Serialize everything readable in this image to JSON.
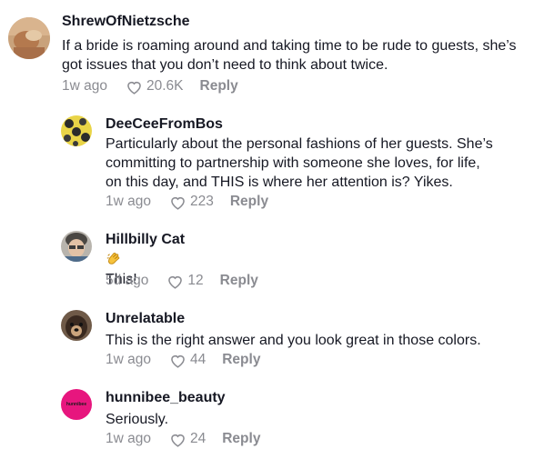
{
  "comments": [
    {
      "username": "ShrewOfNietzsche",
      "text": "If a bride is roaming around and taking time to be rude to guests, she’s got issues that you don’t need to think about twice.",
      "time": "1w ago",
      "likes": "20.6K",
      "reply_label": "Reply"
    },
    {
      "username": "DeeCeeFromBos",
      "text": "Particularly about the personal fashions of her guests. She’s committing to partnership with someone she loves, for life, on this day, and THIS is where her attention is? Yikes.",
      "time": "1w ago",
      "likes": "223",
      "reply_label": "Reply"
    },
    {
      "username": "Hillbilly Cat",
      "text": "This!",
      "emoji": "clapping-hands-emoji",
      "time": "5d ago",
      "likes": "12",
      "reply_label": "Reply"
    },
    {
      "username": "Unrelatable",
      "text": "This is the right answer and you look great in those colors.",
      "time": "1w ago",
      "likes": "44",
      "reply_label": "Reply"
    },
    {
      "username": "hunnibee_beauty",
      "text": "Seriously.",
      "avatar_text": "hunnibee",
      "time": "1w ago",
      "likes": "24",
      "reply_label": "Reply"
    }
  ],
  "colors": {
    "text": "#161823",
    "muted": "#8a8b91",
    "hunnibee_avatar": "#e7167e"
  },
  "icons": {
    "like": "heart-outline-icon"
  }
}
